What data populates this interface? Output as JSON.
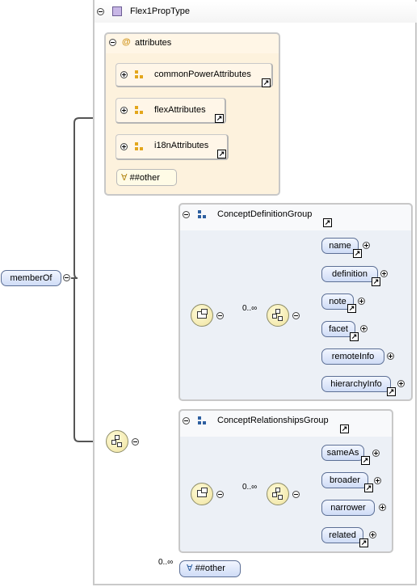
{
  "root": {
    "label": "memberOf"
  },
  "type": {
    "title": "Flex1PropType"
  },
  "attributes": {
    "title": "attributes",
    "at_symbol": "@",
    "groups": [
      {
        "label": "commonPowerAttributes"
      },
      {
        "label": "flexAttributes"
      },
      {
        "label": "i18nAttributes"
      }
    ],
    "any_attribute": {
      "symbol": "∀",
      "label": "##other"
    }
  },
  "groups": [
    {
      "title": "ConceptDefinitionGroup",
      "occurrence": "0..∞",
      "elements": [
        {
          "label": "name"
        },
        {
          "label": "definition"
        },
        {
          "label": "note"
        },
        {
          "label": "facet"
        },
        {
          "label": "remoteInfo"
        },
        {
          "label": "hierarchyInfo"
        }
      ]
    },
    {
      "title": "ConceptRelationshipsGroup",
      "occurrence": "0..∞",
      "elements": [
        {
          "label": "sameAs"
        },
        {
          "label": "broader"
        },
        {
          "label": "narrower"
        },
        {
          "label": "related"
        }
      ]
    }
  ],
  "any_element": {
    "occurrence": "0..∞",
    "symbol": "∀",
    "label": "##other"
  },
  "colors": {
    "attr_bg": "#fdf2dd",
    "group_bg": "#ecf0f6",
    "element_fill": "#cfdcf6",
    "element_border": "#5c6f95",
    "compositor_fill": "#efe3a0",
    "attr_group_icon": "#e3a61c",
    "model_group_icon": "#2d5fa0"
  },
  "icons": [
    "collapse-icon",
    "expand-icon",
    "complex-type-icon",
    "attribute-group-icon",
    "model-group-icon",
    "link-icon",
    "sequence-icon",
    "choice-icon"
  ]
}
